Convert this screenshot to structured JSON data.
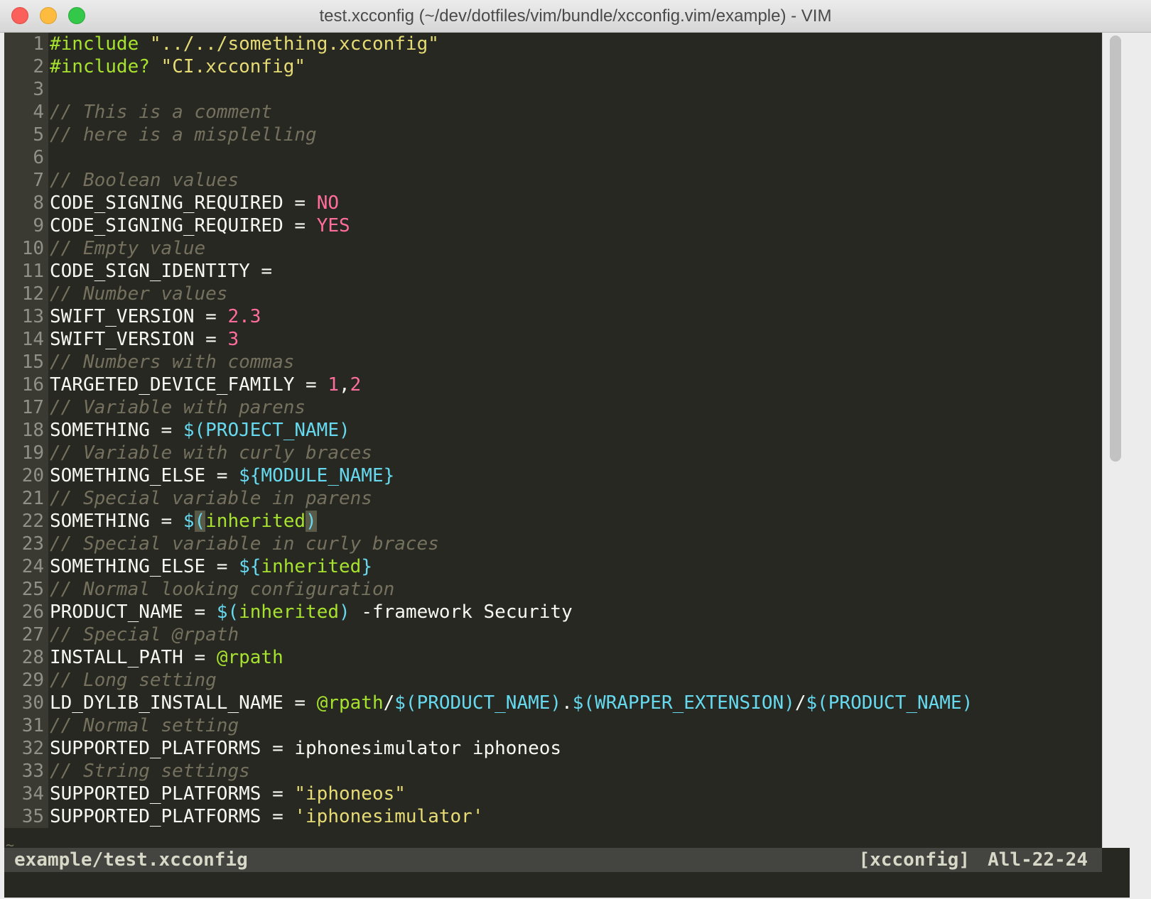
{
  "window": {
    "title": "test.xcconfig (~/dev/dotfiles/vim/bundle/xcconfig.vim/example) - VIM"
  },
  "editor": {
    "lines": [
      {
        "n": "1",
        "tokens": [
          {
            "t": "#include",
            "c": "kw"
          },
          {
            "t": " ",
            "c": ""
          },
          {
            "t": "\"../../something.xcconfig\"",
            "c": "str"
          }
        ]
      },
      {
        "n": "2",
        "tokens": [
          {
            "t": "#include?",
            "c": "kw"
          },
          {
            "t": " ",
            "c": ""
          },
          {
            "t": "\"CI.xcconfig\"",
            "c": "str"
          }
        ]
      },
      {
        "n": "3",
        "tokens": []
      },
      {
        "n": "4",
        "tokens": [
          {
            "t": "// This is a comment",
            "c": "cmt"
          }
        ]
      },
      {
        "n": "5",
        "tokens": [
          {
            "t": "// here is a misplelling",
            "c": "cmt"
          }
        ]
      },
      {
        "n": "6",
        "tokens": []
      },
      {
        "n": "7",
        "tokens": [
          {
            "t": "// Boolean values",
            "c": "cmt"
          }
        ]
      },
      {
        "n": "8",
        "tokens": [
          {
            "t": "CODE_SIGNING_REQUIRED = ",
            "c": ""
          },
          {
            "t": "NO",
            "c": "num"
          }
        ]
      },
      {
        "n": "9",
        "tokens": [
          {
            "t": "CODE_SIGNING_REQUIRED = ",
            "c": ""
          },
          {
            "t": "YES",
            "c": "num"
          }
        ]
      },
      {
        "n": "10",
        "tokens": [
          {
            "t": "// Empty value",
            "c": "cmt"
          }
        ]
      },
      {
        "n": "11",
        "tokens": [
          {
            "t": "CODE_SIGN_IDENTITY =",
            "c": ""
          }
        ]
      },
      {
        "n": "12",
        "tokens": [
          {
            "t": "// Number values",
            "c": "cmt"
          }
        ]
      },
      {
        "n": "13",
        "tokens": [
          {
            "t": "SWIFT_VERSION = ",
            "c": ""
          },
          {
            "t": "2.3",
            "c": "num"
          }
        ]
      },
      {
        "n": "14",
        "tokens": [
          {
            "t": "SWIFT_VERSION = ",
            "c": ""
          },
          {
            "t": "3",
            "c": "num"
          }
        ]
      },
      {
        "n": "15",
        "tokens": [
          {
            "t": "// Numbers with commas",
            "c": "cmt"
          }
        ]
      },
      {
        "n": "16",
        "tokens": [
          {
            "t": "TARGETED_DEVICE_FAMILY = ",
            "c": ""
          },
          {
            "t": "1",
            "c": "num"
          },
          {
            "t": ",",
            "c": ""
          },
          {
            "t": "2",
            "c": "num"
          }
        ]
      },
      {
        "n": "17",
        "tokens": [
          {
            "t": "// Variable with parens",
            "c": "cmt"
          }
        ]
      },
      {
        "n": "18",
        "tokens": [
          {
            "t": "SOMETHING = ",
            "c": ""
          },
          {
            "t": "$(PROJECT_NAME)",
            "c": "var"
          }
        ]
      },
      {
        "n": "19",
        "tokens": [
          {
            "t": "// Variable with curly braces",
            "c": "cmt"
          }
        ]
      },
      {
        "n": "20",
        "tokens": [
          {
            "t": "SOMETHING_ELSE = ",
            "c": ""
          },
          {
            "t": "${MODULE_NAME}",
            "c": "var"
          }
        ]
      },
      {
        "n": "21",
        "tokens": [
          {
            "t": "// Special variable in parens",
            "c": "cmt"
          }
        ]
      },
      {
        "n": "22",
        "tokens": [
          {
            "t": "SOMETHING = ",
            "c": ""
          },
          {
            "t": "$",
            "c": "var"
          },
          {
            "t": "(",
            "c": "var hl"
          },
          {
            "t": "inherited",
            "c": "vlit"
          },
          {
            "t": ")",
            "c": "var hl"
          }
        ]
      },
      {
        "n": "23",
        "tokens": [
          {
            "t": "// Special variable in curly braces",
            "c": "cmt"
          }
        ]
      },
      {
        "n": "24",
        "tokens": [
          {
            "t": "SOMETHING_ELSE = ",
            "c": ""
          },
          {
            "t": "${",
            "c": "var"
          },
          {
            "t": "inherited",
            "c": "vlit"
          },
          {
            "t": "}",
            "c": "var"
          }
        ]
      },
      {
        "n": "25",
        "tokens": [
          {
            "t": "// Normal looking configuration",
            "c": "cmt"
          }
        ]
      },
      {
        "n": "26",
        "tokens": [
          {
            "t": "PRODUCT_NAME = ",
            "c": ""
          },
          {
            "t": "$(",
            "c": "var"
          },
          {
            "t": "inherited",
            "c": "vlit"
          },
          {
            "t": ")",
            "c": "var"
          },
          {
            "t": " -framework Security",
            "c": ""
          }
        ]
      },
      {
        "n": "27",
        "tokens": [
          {
            "t": "// Special @rpath",
            "c": "cmt"
          }
        ]
      },
      {
        "n": "28",
        "tokens": [
          {
            "t": "INSTALL_PATH = ",
            "c": ""
          },
          {
            "t": "@rpath",
            "c": "vlit"
          }
        ]
      },
      {
        "n": "29",
        "tokens": [
          {
            "t": "// Long setting",
            "c": "cmt"
          }
        ]
      },
      {
        "n": "30",
        "tokens": [
          {
            "t": "LD_DYLIB_INSTALL_NAME = ",
            "c": ""
          },
          {
            "t": "@rpath",
            "c": "vlit"
          },
          {
            "t": "/",
            "c": ""
          },
          {
            "t": "$(PRODUCT_NAME)",
            "c": "var"
          },
          {
            "t": ".",
            "c": ""
          },
          {
            "t": "$(WRAPPER_EXTENSION)",
            "c": "var"
          },
          {
            "t": "/",
            "c": ""
          },
          {
            "t": "$(PRODUCT_NAME)",
            "c": "var"
          }
        ]
      },
      {
        "n": "31",
        "tokens": [
          {
            "t": "// Normal setting",
            "c": "cmt"
          }
        ]
      },
      {
        "n": "32",
        "tokens": [
          {
            "t": "SUPPORTED_PLATFORMS = iphonesimulator iphoneos",
            "c": ""
          }
        ]
      },
      {
        "n": "33",
        "tokens": [
          {
            "t": "// String settings",
            "c": "cmt"
          }
        ]
      },
      {
        "n": "34",
        "tokens": [
          {
            "t": "SUPPORTED_PLATFORMS = ",
            "c": ""
          },
          {
            "t": "\"iphoneos\"",
            "c": "str"
          }
        ]
      },
      {
        "n": "35",
        "tokens": [
          {
            "t": "SUPPORTED_PLATFORMS = ",
            "c": ""
          },
          {
            "t": "'iphonesimulator'",
            "c": "str"
          }
        ]
      }
    ],
    "empty_line_marker": "~"
  },
  "statusline": {
    "filename": "example/test.xcconfig",
    "filetype": "[xcconfig]",
    "position": "All-22-24"
  },
  "colors": {
    "background": "#272822",
    "keyword": "#a6e22e",
    "string": "#e6db74",
    "comment": "#75715e",
    "number": "#ff6e9b",
    "variable": "#66d9ef"
  }
}
